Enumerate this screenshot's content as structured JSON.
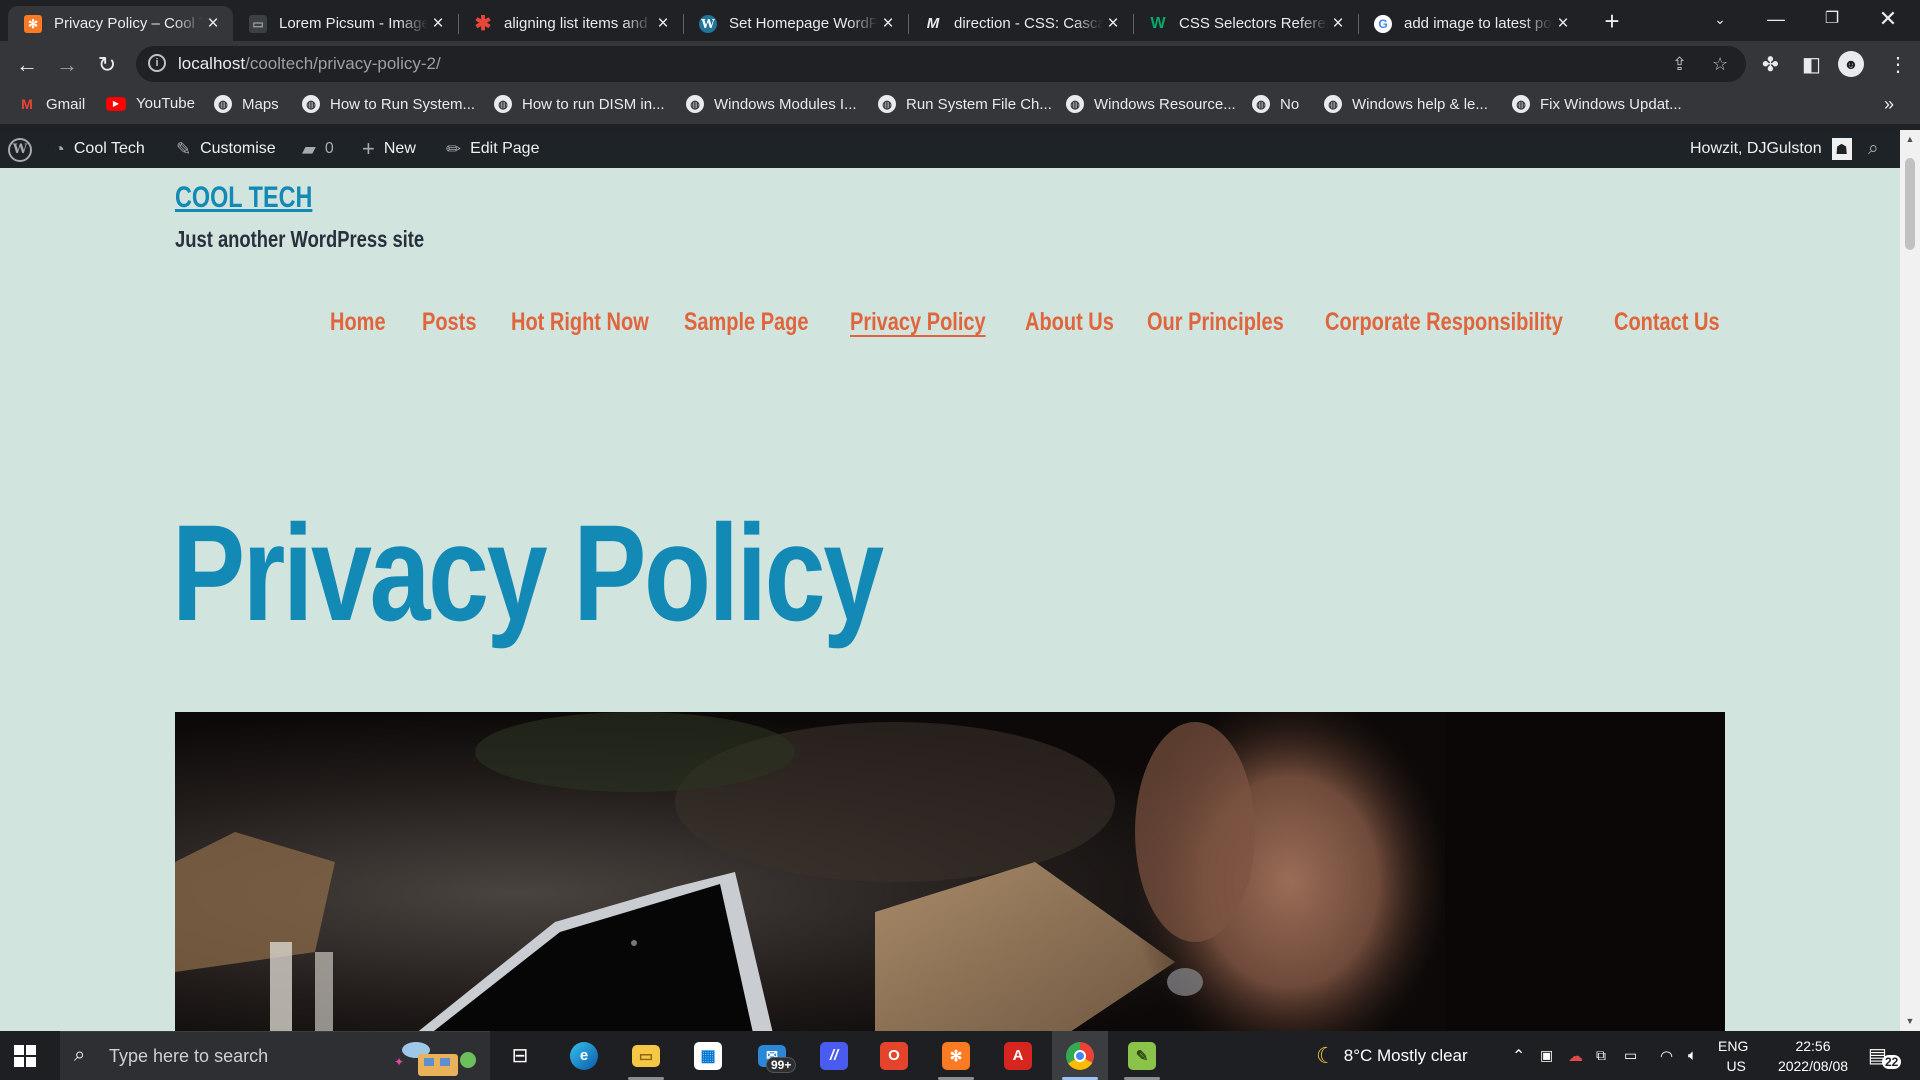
{
  "browser": {
    "tabs": [
      {
        "title": "Privacy Policy – Cool Tech",
        "icon": "xampp-icon",
        "icon_color": "#fb7a24",
        "active": true
      },
      {
        "title": "Lorem Picsum - Images",
        "icon": "picsum-icon",
        "icon_color": "#3c4043",
        "active": false
      },
      {
        "title": "aligning list items and",
        "icon": "asterisk-icon",
        "icon_color": "#e8453c",
        "active": false
      },
      {
        "title": "Set Homepage WordPress",
        "icon": "wordpress-icon",
        "icon_color": "#21759b",
        "active": false
      },
      {
        "title": "direction - CSS: Cascading",
        "icon": "mdn-icon",
        "icon_color": "#e8eaed",
        "active": false
      },
      {
        "title": "CSS Selectors Reference",
        "icon": "w3schools-icon",
        "icon_color": "#04aa6d",
        "active": false
      },
      {
        "title": "add image to latest posts",
        "icon": "google-icon",
        "icon_color": "#4285f4",
        "active": false
      }
    ],
    "url_host": "localhost",
    "url_path": "/cooltech/privacy-policy-2/",
    "bookmarks": [
      {
        "label": "Gmail",
        "icon": "gmail-icon"
      },
      {
        "label": "YouTube",
        "icon": "youtube-icon"
      },
      {
        "label": "Maps",
        "icon": "globe-icon"
      },
      {
        "label": "How to Run System...",
        "icon": "globe-icon"
      },
      {
        "label": "How to run DISM in...",
        "icon": "globe-icon"
      },
      {
        "label": "Windows Modules I...",
        "icon": "globe-icon"
      },
      {
        "label": "Run System File Ch...",
        "icon": "globe-icon"
      },
      {
        "label": "Windows Resource...",
        "icon": "globe-icon"
      },
      {
        "label": "No",
        "icon": "globe-icon"
      },
      {
        "label": "Windows help & le...",
        "icon": "globe-icon"
      },
      {
        "label": "Fix Windows Updat...",
        "icon": "globe-icon"
      }
    ]
  },
  "adminbar": {
    "site_name": "Cool Tech",
    "customise": "Customise",
    "comments_count": "0",
    "new_label": "New",
    "edit_label": "Edit Page",
    "greeting": "Howzit, DJGulston"
  },
  "site": {
    "title": "COOL TECH",
    "description": "Just another WordPress site",
    "nav": [
      "Home",
      "Posts",
      "Hot Right Now",
      "Sample Page",
      "Privacy Policy",
      "About Us",
      "Our Principles",
      "Corporate Responsibility",
      "Contact Us"
    ],
    "current_nav": "Privacy Policy",
    "page_title": "Privacy Policy",
    "colors": {
      "background": "#d1e4dd",
      "title": "#1389b6",
      "nav": "#e0653c",
      "text": "#28303d"
    }
  },
  "taskbar": {
    "search_placeholder": "Type here to search",
    "mail_badge": "99+",
    "weather": "8°C  Mostly clear",
    "lang_top": "ENG",
    "lang_bottom": "US",
    "time": "22:56",
    "date": "2022/08/08",
    "notifications": "22"
  }
}
